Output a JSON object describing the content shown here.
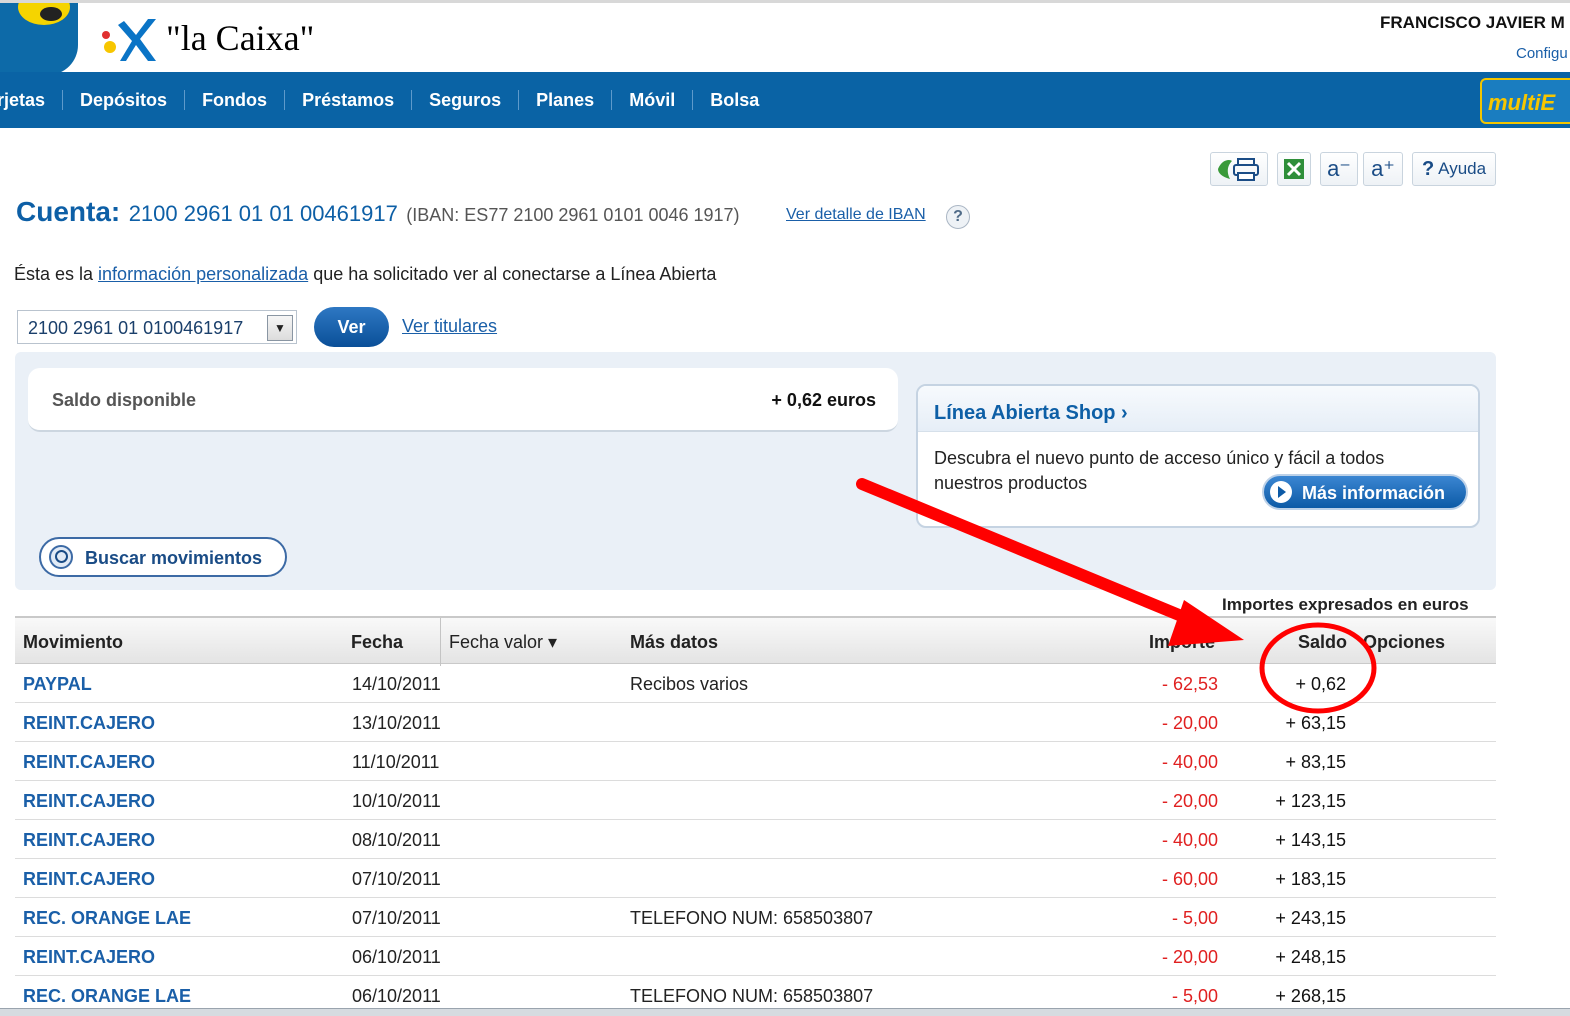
{
  "header": {
    "logo_text": "\"la Caixa\"",
    "user_name": "FRANCISCO JAVIER M",
    "config_link": "Configu"
  },
  "nav": {
    "items": [
      "rjetas",
      "Depósitos",
      "Fondos",
      "Préstamos",
      "Seguros",
      "Planes",
      "Móvil",
      "Bolsa"
    ],
    "badge": "multiE"
  },
  "toolbar": {
    "text_smaller": "a⁻",
    "text_larger": "a⁺",
    "help_label": "Ayuda"
  },
  "account": {
    "label": "Cuenta:",
    "number": "2100 2961 01 01 00461917",
    "iban": "(IBAN: ES77 2100 2961 0101 0046 1917)",
    "iban_link": "Ver detalle de IBAN",
    "help_mark": "?"
  },
  "info": {
    "prefix": "Ésta es la ",
    "link": "información personalizada",
    "suffix": " que ha solicitado ver al conectarse a Línea Abierta"
  },
  "selector": {
    "value": "2100 2961 01 0100461917",
    "ver_button": "Ver",
    "titulares_link": "Ver titulares"
  },
  "summary": {
    "saldo_label": "Saldo disponible",
    "saldo_value": "+ 0,62 euros",
    "buscar_label": "Buscar movimientos"
  },
  "shop": {
    "title": "Línea Abierta Shop ›",
    "description": "Descubra el nuevo punto de acceso único y fácil a todos nuestros productos",
    "button": "Más información"
  },
  "table": {
    "note": "Importes expresados en euros",
    "headers": {
      "movimiento": "Movimiento",
      "fecha": "Fecha",
      "fecha_valor": "Fecha valor ▾",
      "mas_datos": "Más datos",
      "importe": "Importe",
      "saldo": "Saldo",
      "opciones": "Opciones"
    },
    "rows": [
      {
        "movimiento": "PAYPAL",
        "fecha": "14/10/2011",
        "datos": "Recibos varios",
        "importe": "- 62,53",
        "saldo": "+ 0,62"
      },
      {
        "movimiento": "REINT.CAJERO",
        "fecha": "13/10/2011",
        "datos": "",
        "importe": "- 20,00",
        "saldo": "+ 63,15"
      },
      {
        "movimiento": "REINT.CAJERO",
        "fecha": "11/10/2011",
        "datos": "",
        "importe": "- 40,00",
        "saldo": "+ 83,15"
      },
      {
        "movimiento": "REINT.CAJERO",
        "fecha": "10/10/2011",
        "datos": "",
        "importe": "- 20,00",
        "saldo": "+ 123,15"
      },
      {
        "movimiento": "REINT.CAJERO",
        "fecha": "08/10/2011",
        "datos": "",
        "importe": "- 40,00",
        "saldo": "+ 143,15"
      },
      {
        "movimiento": "REINT.CAJERO",
        "fecha": "07/10/2011",
        "datos": "",
        "importe": "- 60,00",
        "saldo": "+ 183,15"
      },
      {
        "movimiento": "REC. ORANGE LAE",
        "fecha": "07/10/2011",
        "datos": "TELEFONO NUM: 658503807",
        "importe": "- 5,00",
        "saldo": "+ 243,15"
      },
      {
        "movimiento": "REINT.CAJERO",
        "fecha": "06/10/2011",
        "datos": "",
        "importe": "- 20,00",
        "saldo": "+ 248,15"
      },
      {
        "movimiento": "REC. ORANGE LAE",
        "fecha": "06/10/2011",
        "datos": "TELEFONO NUM: 658503807",
        "importe": "- 5,00",
        "saldo": "+ 268,15"
      }
    ]
  },
  "colors": {
    "nav_blue": "#0a63a5",
    "link_blue": "#1a5fa8",
    "negative_red": "#e02020",
    "annotation_red": "#ff0000"
  }
}
